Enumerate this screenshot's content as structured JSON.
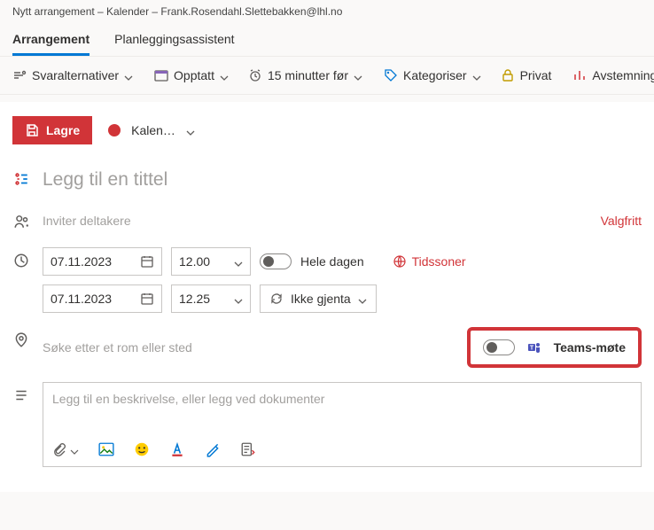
{
  "window_title": "Nytt arrangement – Kalender – Frank.Rosendahl.Slettebakken@lhl.no",
  "tabs": {
    "arrangement": "Arrangement",
    "planlegging": "Planleggingsassistent"
  },
  "ribbon": {
    "svaralternativer": "Svaralternativer",
    "opptatt": "Opptatt",
    "reminder": "15 minutter før",
    "kategoriser": "Kategoriser",
    "privat": "Privat",
    "avstemning": "Avstemning"
  },
  "save": "Lagre",
  "calendar_name": "Kalen…",
  "title_placeholder": "Legg til en tittel",
  "invite_placeholder": "Inviter deltakere",
  "optional": "Valgfritt",
  "dates": {
    "start_date": "07.11.2023",
    "start_time": "12.00",
    "end_date": "07.11.2023",
    "end_time": "12.25"
  },
  "allday": "Hele dagen",
  "timezones": "Tidssoner",
  "repeat": "Ikke gjenta",
  "location_placeholder": "Søke etter et rom eller sted",
  "teams": "Teams-møte",
  "desc_placeholder": "Legg til en beskrivelse, eller legg ved dokumenter"
}
